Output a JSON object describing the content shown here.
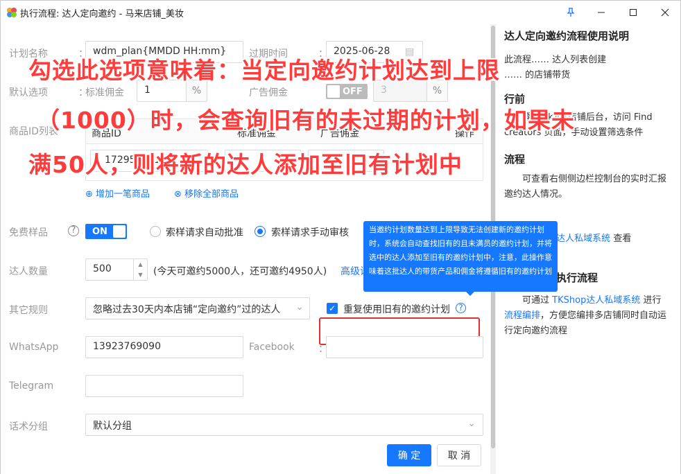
{
  "window": {
    "title": "执行流程: 达人定向邀约 - 马来店铺_美妆",
    "pin_icon": "pin-icon",
    "min_icon": "minimize-icon",
    "max_icon": "maximize-icon",
    "close_icon": "close-icon"
  },
  "form": {
    "plan_name": {
      "label": "计划名称",
      "value": "wdm_plan{MMDD HH:mm}"
    },
    "expire": {
      "label": "过期时间",
      "value": "2025-06-28"
    },
    "default_opts": {
      "label": "默认选项",
      "std_commission_label": "标准佣金",
      "std_commission_value": "1",
      "std_suffix": "%",
      "ad_commission_label": "广告佣金",
      "ad_toggle": "OFF",
      "ad_value": "3",
      "ad_suffix": "%"
    },
    "product_list": {
      "label": "商品ID列表",
      "headers": [
        "商品ID",
        "标准佣金",
        "广告佣金",
        "操作"
      ],
      "row_id": "172959991"
    },
    "add_product": "增加一笔商品",
    "remove_all": "移除全部商品",
    "free_sample": {
      "label": "免费样品",
      "toggle": "ON",
      "opt_auto": "索样请求自动批准",
      "opt_manual": "索样请求手动审核",
      "selected": "manual"
    },
    "creator_count": {
      "label": "达人数量",
      "value": "500",
      "note": "(今天可邀约5000人，还可邀约4950人)",
      "advanced": "高级设置"
    },
    "other_rules": {
      "label": "其它规则",
      "select_value": "忽略过去30天内本店铺“定向邀约”过的达人",
      "checkbox_label": "重复使用旧有的邀约计划",
      "checked": true
    },
    "whatsapp": {
      "label": "WhatsApp",
      "value": "13923769090"
    },
    "facebook": {
      "label": "Facebook",
      "value": ""
    },
    "telegram": {
      "label": "Telegram",
      "value": ""
    },
    "script_group": {
      "label": "话术分组",
      "value": "默认分组"
    },
    "colon": "："
  },
  "tooltip": "当邀约计划数量达到上限导致无法创建新的邀约计划时，系统会自动查找旧有的且未满员的邀约计划，并将选中的达人添加至旧有的邀约计划中，注意，此操作意味着这批达人的带货产品和佣金将遵循旧有的邀约计划",
  "buttons": {
    "confirm": "确 定",
    "cancel": "取 消"
  },
  "sidebar": {
    "title": "达人定向邀约流程使用说明",
    "p1_a": "此流程",
    "p1_b": "达人列表创建",
    "p1_c": "的店铺带货",
    "h2": "行前",
    "p2_a": "登录TikTok店铺后台，访问 Find creators 页面，手动设置筛选条件",
    "h3": "流程",
    "p3": "可查看右侧侧边栏控制台的实时汇报邀约达人情况。",
    "p4_link": "TKShop达人私域系统",
    "p4_tail": "查看",
    "h5": "多店铺同时执行流程",
    "p5_a": "可通过",
    "p5_link1": "TKShop达人私域系统",
    "p5_b": "进行",
    "p5_link2": "流程编排",
    "p5_c": "，方便您编排多店铺同时自动运行定向邀约流程"
  },
  "overlay": {
    "line1": "勾选此选项意味着：当定向邀约计划达到上限",
    "line2": "（1000）时，会查询旧有的未过期的计划，如果未",
    "line3": "满50人，则将新的达人添加至旧有计划中"
  }
}
